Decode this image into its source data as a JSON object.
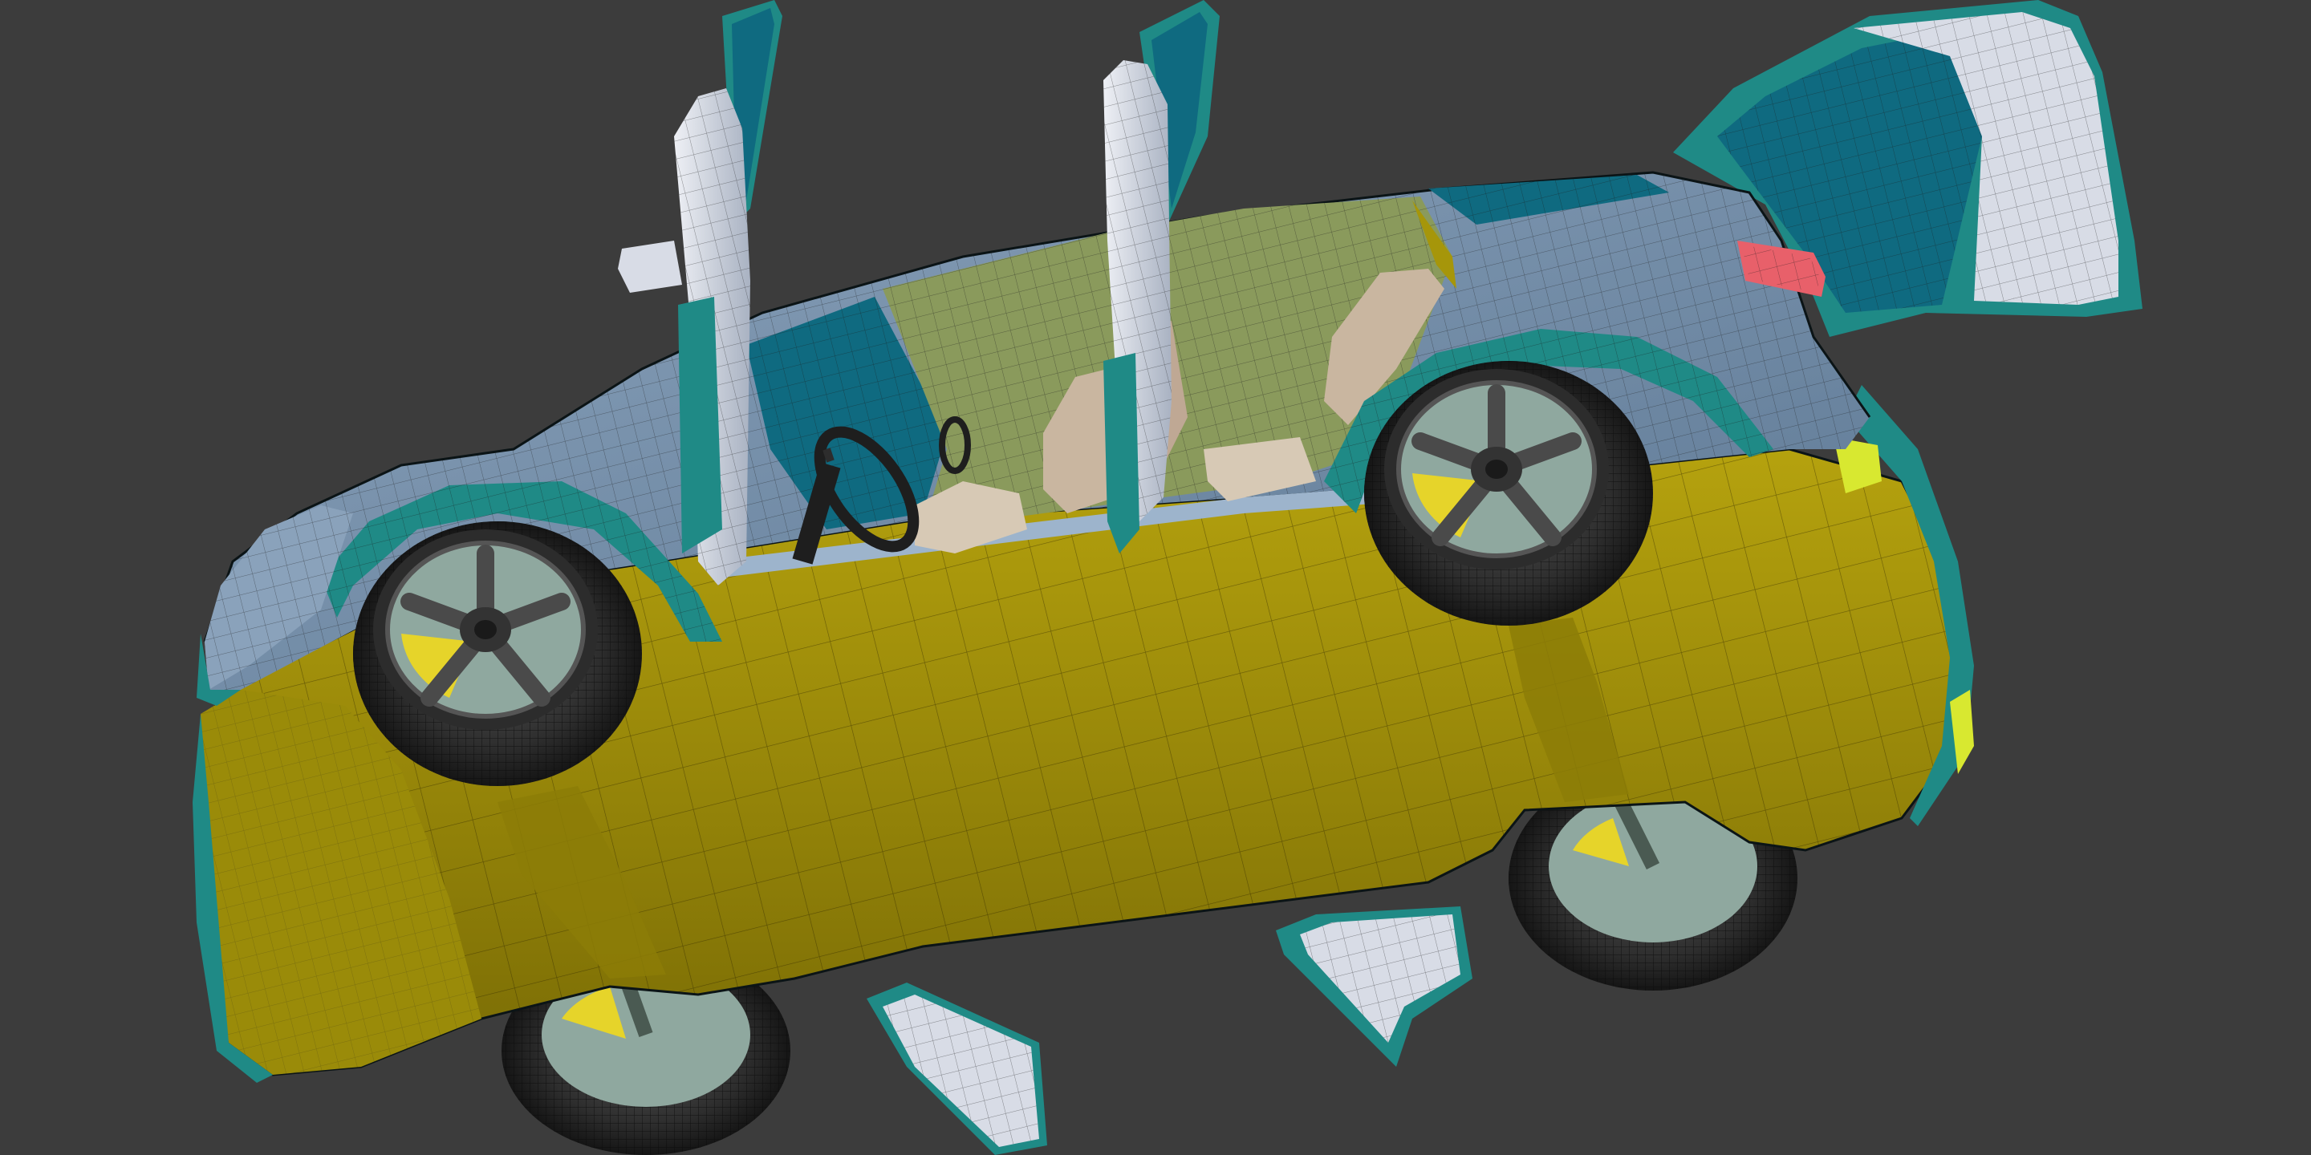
{
  "viewport": {
    "background_color": "#3c3c3c",
    "shading_mode": "wireframe-on-shaded"
  },
  "model": {
    "colors": {
      "underbody": "#a6960a",
      "underbody_dark": "#7f7206",
      "body_panel": "#6e88a4",
      "body_panel_light": "#8aa2bb",
      "fender_trim": "#1f8a86",
      "glass": "#0f6a80",
      "interior": "#8a9a5c",
      "seat": "#d7c9b5",
      "door_inner": "#d8dce6",
      "tail_light": "#e8606a",
      "marker_light": "#d8e830",
      "tire": "#2a2a2a",
      "rim": "#6e6e6e",
      "brake_caliper": "#e6d42a"
    },
    "parts": [
      "underbody",
      "front-left-wheel",
      "rear-left-wheel",
      "front-right-wheel",
      "rear-right-wheel",
      "driver-door-open",
      "rear-door-open",
      "tailgate-open",
      "windshield",
      "interior-cabin",
      "seats",
      "steering-wheel",
      "tail-light",
      "side-marker-lights"
    ]
  }
}
